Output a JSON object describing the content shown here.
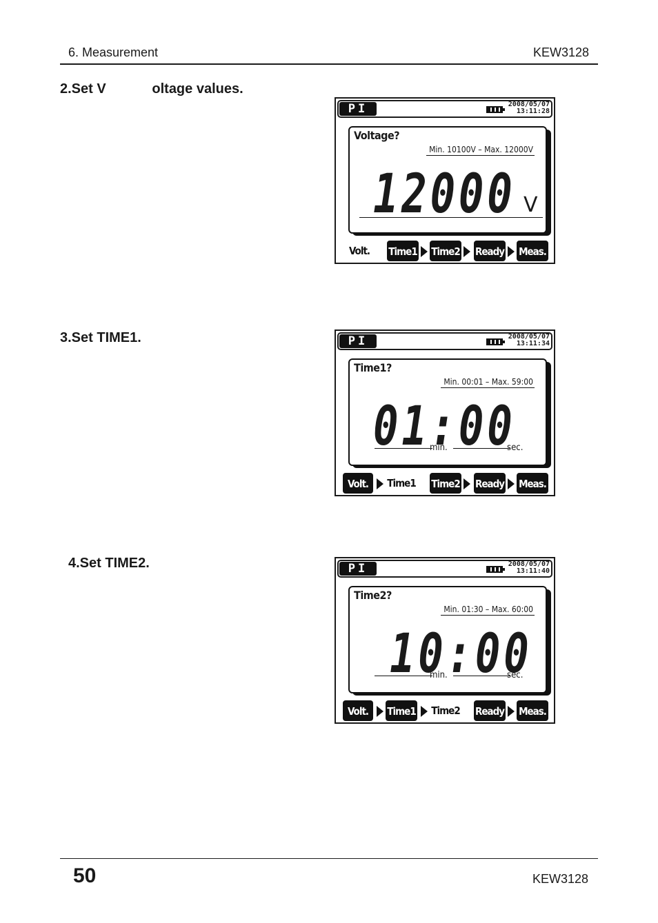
{
  "header": {
    "section": "6. Measurement",
    "model": "KEW3128"
  },
  "footer": {
    "page_number": "50",
    "model": "KEW3128"
  },
  "steps": [
    {
      "title": "2.Set V            oltage values.",
      "screen": {
        "mode": "PI",
        "date": "2008/05/07",
        "time": "13:11:28",
        "prompt": "Voltage?",
        "range": "Min. 10100V  –  Max. 12000V",
        "value": "12000",
        "unit": "V",
        "nav": [
          "Volt.",
          "Time1",
          "Time2",
          "Ready",
          "Meas."
        ],
        "active": "Volt."
      }
    },
    {
      "title": "3.Set TIME1.",
      "screen": {
        "mode": "PI",
        "date": "2008/05/07",
        "time": "13:11:34",
        "prompt": "Time1?",
        "range": "Min. 00:01  –  Max. 59:00",
        "value": "01:00",
        "unit_min": "min.",
        "unit_sec": "sec.",
        "nav": [
          "Volt.",
          "Time1",
          "Time2",
          "Ready",
          "Meas."
        ],
        "active": "Time1"
      }
    },
    {
      "title": "4.Set TIME2.",
      "screen": {
        "mode": "PI",
        "date": "2008/05/07",
        "time": "13:11:40",
        "prompt": "Time2?",
        "range": "Min. 01:30  –  Max. 60:00",
        "value": "10:00",
        "unit_min": "min.",
        "unit_sec": "sec.",
        "nav": [
          "Volt.",
          "Time1",
          "Time2",
          "Ready",
          "Meas."
        ],
        "active": "Time2"
      }
    }
  ]
}
